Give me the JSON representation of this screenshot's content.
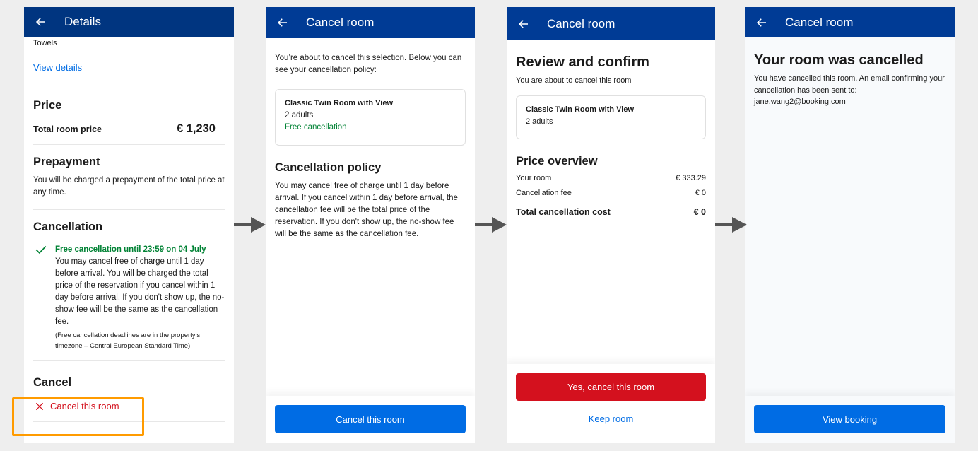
{
  "screens": [
    {
      "header": {
        "title": "Details",
        "back_icon": "arrow-left-icon"
      },
      "facility_item": "Towels",
      "view_details_link": "View details",
      "price": {
        "heading": "Price",
        "label": "Total room price",
        "value": "€ 1,230"
      },
      "prepayment": {
        "heading": "Prepayment",
        "text": "You will be charged a prepayment of the total price at any time."
      },
      "cancellation": {
        "heading": "Cancellation",
        "check_icon": "checkmark-icon",
        "free_until": "Free cancellation until 23:59 on 04 July",
        "policy": "You may cancel free of charge until 1 day before arrival. You will be charged the total price of the reservation if you cancel within 1 day before arrival. If you don't show up, the no-show fee will be the same as the cancellation fee.",
        "timezone_note": "(Free cancellation deadlines are in the property's timezone – Central European Standard Time)"
      },
      "cancel_section": {
        "heading": "Cancel",
        "action_icon": "close-x-icon",
        "action_label": "Cancel this room"
      }
    },
    {
      "header": {
        "title": "Cancel room",
        "back_icon": "arrow-left-icon"
      },
      "intro": "You’re about to cancel this selection. Below you can see your cancellation policy:",
      "room_card": {
        "name": "Classic Twin Room with View",
        "guests": "2 adults",
        "cancellation_tag": "Free cancellation"
      },
      "policy": {
        "heading": "Cancellation policy",
        "text": "You may cancel free of charge until 1 day before arrival. If you cancel within 1 day before arrival, the cancellation fee will be the total price of the reservation. If you don't show up, the no-show fee will be the same as the cancellation fee."
      },
      "footer_button": "Cancel this room"
    },
    {
      "header": {
        "title": "Cancel room",
        "back_icon": "arrow-left-icon"
      },
      "heading": "Review and confirm",
      "subtext": "You are about to cancel this room",
      "room_card": {
        "name": "Classic Twin Room with View",
        "guests": "2 adults"
      },
      "price_overview": {
        "heading": "Price overview",
        "rows": [
          {
            "label": "Your room",
            "value": "€ 333.29"
          },
          {
            "label": "Cancellation fee",
            "value": "€ 0"
          }
        ],
        "total": {
          "label": "Total cancellation cost",
          "value": "€ 0"
        }
      },
      "confirm_button": "Yes, cancel this room",
      "keep_button": "Keep room"
    },
    {
      "header": {
        "title": "Cancel room",
        "back_icon": "arrow-left-icon"
      },
      "heading": "Your room was cancelled",
      "message": "You have cancelled this room. An email confirming your cancellation has been sent to:",
      "email": "jane.wang2@booking.com",
      "footer_button": "View booking"
    }
  ],
  "flow_arrows": [
    "arrow-right-icon",
    "arrow-right-icon",
    "arrow-right-icon"
  ],
  "colors": {
    "header_blue": "#003b95",
    "primary_blue": "#006ce4",
    "danger_red": "#d4111e",
    "success_green": "#008234",
    "highlight_orange": "#ff9b00"
  }
}
